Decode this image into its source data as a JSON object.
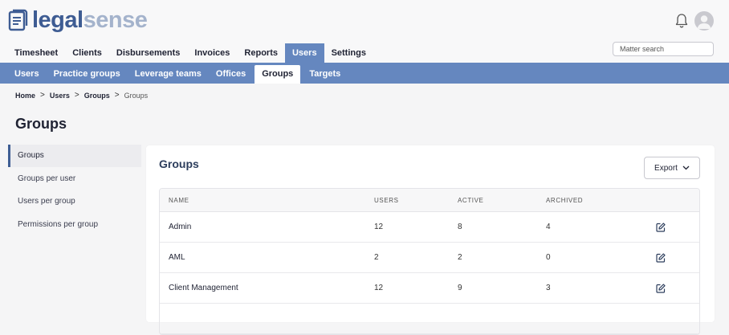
{
  "brand": {
    "name_part1": "legal",
    "name_part2": "sense"
  },
  "main_nav": [
    {
      "label": "Timesheet",
      "active": false
    },
    {
      "label": "Clients",
      "active": false
    },
    {
      "label": "Disbursements",
      "active": false
    },
    {
      "label": "Invoices",
      "active": false
    },
    {
      "label": "Reports",
      "active": false
    },
    {
      "label": "Users",
      "active": true
    },
    {
      "label": "Settings",
      "active": false
    }
  ],
  "search": {
    "placeholder": "Matter search"
  },
  "sub_nav": [
    {
      "label": "Users",
      "active": false
    },
    {
      "label": "Practice groups",
      "active": false
    },
    {
      "label": "Leverage teams",
      "active": false
    },
    {
      "label": "Offices",
      "active": false
    },
    {
      "label": "Groups",
      "active": true
    },
    {
      "label": "Targets",
      "active": false
    }
  ],
  "breadcrumb": {
    "items": [
      "Home",
      "Users",
      "Groups"
    ],
    "current": "Groups",
    "separator": ">"
  },
  "page_title": "Groups",
  "side_menu": [
    {
      "label": "Groups",
      "active": true
    },
    {
      "label": "Groups per user",
      "active": false
    },
    {
      "label": "Users per group",
      "active": false
    },
    {
      "label": "Permissions per group",
      "active": false
    }
  ],
  "card": {
    "title": "Groups",
    "export_label": "Export",
    "columns": [
      "NAME",
      "USERS",
      "ACTIVE",
      "ARCHIVED"
    ],
    "rows": [
      {
        "name": "Admin",
        "users": "12",
        "active": "8",
        "archived": "4"
      },
      {
        "name": "AML",
        "users": "2",
        "active": "2",
        "archived": "0"
      },
      {
        "name": "Client Management",
        "users": "12",
        "active": "9",
        "archived": "3"
      }
    ]
  },
  "colors": {
    "accent": "#6587bf",
    "brand_dark": "#3e5c93",
    "brand_light": "#a4b3cc"
  },
  "icons": {
    "bell": "bell-icon",
    "avatar": "user-avatar-icon",
    "edit": "edit-icon",
    "chevron": "chevron-down-icon"
  }
}
